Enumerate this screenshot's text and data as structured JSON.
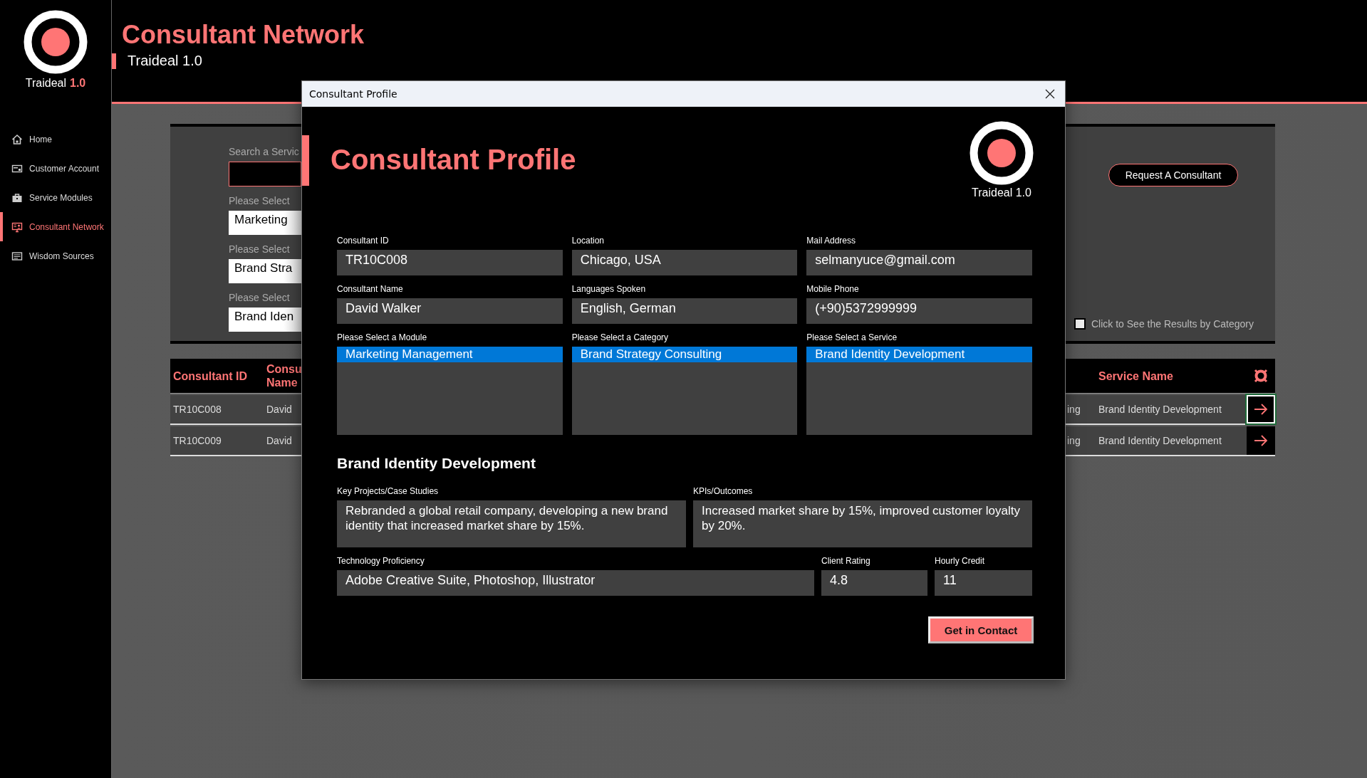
{
  "sidebar": {
    "logo_name": "Traideal",
    "logo_version": "1.0",
    "items": [
      {
        "label": "Home",
        "selected": false
      },
      {
        "label": "Customer Account",
        "selected": false
      },
      {
        "label": "Service Modules",
        "selected": false
      },
      {
        "label": "Consultant Network",
        "selected": true
      },
      {
        "label": "Wisdom Sources",
        "selected": false
      }
    ]
  },
  "header": {
    "title": "Consultant Network",
    "subtitle": "Traideal 1.0"
  },
  "filter_panel": {
    "search_label": "Search a Servic",
    "selects": [
      {
        "label": "Please Select",
        "value": "Marketing"
      },
      {
        "label": "Please Select",
        "value": "Brand Stra"
      },
      {
        "label": "Please Select",
        "value": "Brand Iden"
      }
    ],
    "request_button": "Request A Consultant",
    "category_checkbox": {
      "label": "Click to See the Results by Category",
      "checked": false
    }
  },
  "table": {
    "columns": [
      {
        "label": "Consultant ID"
      },
      {
        "label": "Consu Name"
      },
      {},
      {
        "label": "Service Name"
      }
    ],
    "rows": [
      {
        "cells": [
          "TR10C008",
          "David",
          "ing",
          "Brand Identity Development"
        ],
        "selected": true
      },
      {
        "cells": [
          "TR10C009",
          "David",
          "ing",
          "Brand Identity Development"
        ],
        "selected": false
      }
    ]
  },
  "dialog": {
    "title": "Consultant Profile",
    "heading": "Consultant Profile",
    "logo_text": "Traideal 1.0",
    "fields": [
      {
        "label": "Consultant ID",
        "value": "TR10C008"
      },
      {
        "label": "Location",
        "value": "Chicago, USA"
      },
      {
        "label": "Mail Address",
        "value": "selmanyuce@gmail.com"
      },
      {
        "label": "Consultant Name",
        "value": "David Walker"
      },
      {
        "label": "Languages Spoken",
        "value": "English, German"
      },
      {
        "label": "Mobile Phone",
        "value": "(+90)5372999999"
      }
    ],
    "lists": [
      {
        "label": "Please Select a Module",
        "items": [
          {
            "label": "Marketing Management",
            "selected": true
          }
        ]
      },
      {
        "label": "Please Select a Category",
        "items": [
          {
            "label": "Brand Strategy Consulting",
            "selected": true
          }
        ]
      },
      {
        "label": "Please Select a Service",
        "items": [
          {
            "label": "Brand Identity Development",
            "selected": true
          }
        ]
      }
    ],
    "service_heading": "Brand Identity Development",
    "details": [
      {
        "label": "Key Projects/Case Studies",
        "value": "Rebranded a global retail company, developing a new brand identity that increased market share by 15%."
      },
      {
        "label": "KPIs/Outcomes",
        "value": "Increased market share by 15%, improved customer loyalty by 20%."
      }
    ],
    "stats": [
      {
        "label": "Technology Proficiency",
        "value": "Adobe Creative Suite, Photoshop, Illustrator"
      },
      {
        "label": "Client Rating",
        "value": "4.8"
      },
      {
        "label": "Hourly Credit",
        "value": "11"
      }
    ],
    "contact_button": "Get in Contact"
  }
}
